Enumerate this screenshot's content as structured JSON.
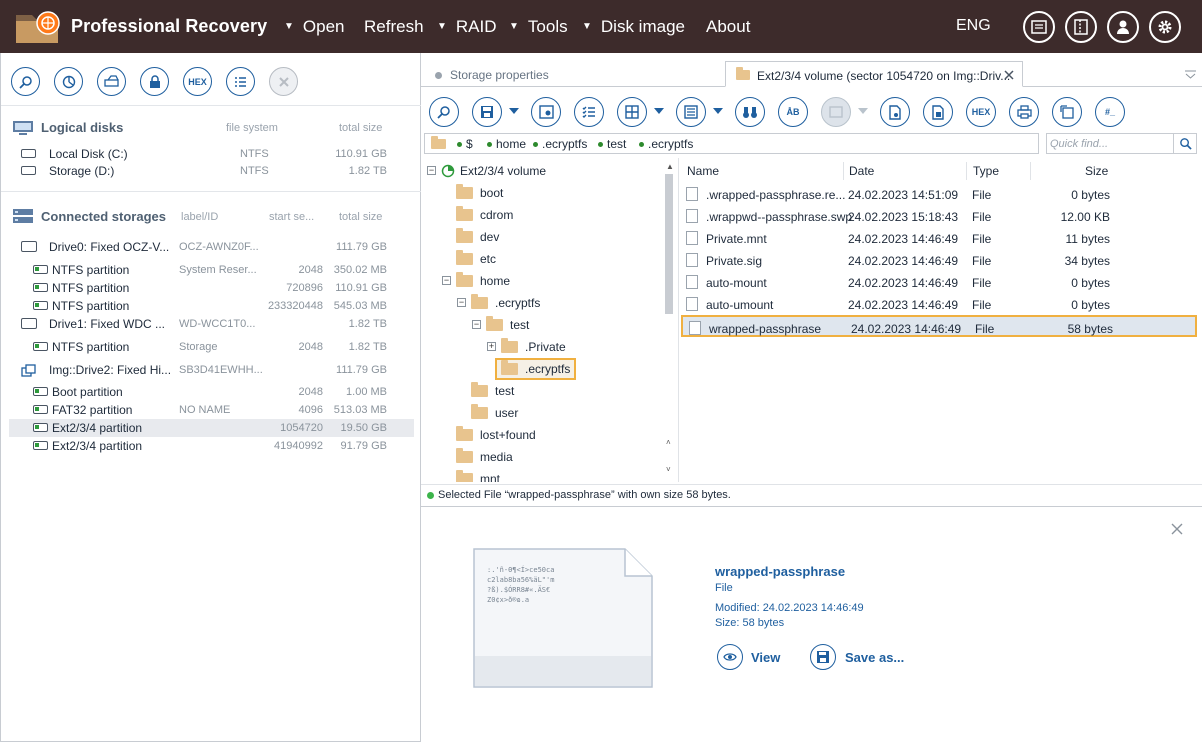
{
  "app": {
    "title": "Professional Recovery",
    "language": "ENG"
  },
  "menu": [
    {
      "label": "Open",
      "arrow": true,
      "x": 0
    },
    {
      "label": "Refresh",
      "arrow": false
    },
    {
      "label": "RAID",
      "arrow": true
    },
    {
      "label": "Tools",
      "arrow": true
    },
    {
      "label": "Disk image",
      "arrow": true
    },
    {
      "label": "About",
      "arrow": false
    }
  ],
  "left_toolbar": {
    "hex_label": "HEX"
  },
  "logical": {
    "title": "Logical disks",
    "col_fs": "file system",
    "col_size": "total size",
    "items": [
      {
        "name": "Local Disk (C:)",
        "fs": "NTFS",
        "size": "110.91 GB"
      },
      {
        "name": "Storage (D:)",
        "fs": "NTFS",
        "size": "1.82 TB"
      }
    ]
  },
  "connected": {
    "title": "Connected storages",
    "col_label": "label/ID",
    "col_start": "start se...",
    "col_size": "total size",
    "items": [
      {
        "name": "Drive0: Fixed OCZ-V...",
        "label": "OCZ-AWNZ0F...",
        "start": "",
        "size": "111.79 GB",
        "kind": "drive"
      },
      {
        "name": "NTFS partition",
        "label": "System Reser...",
        "start": "2048",
        "size": "350.02 MB",
        "kind": "part"
      },
      {
        "name": "NTFS partition",
        "label": "",
        "start": "720896",
        "size": "110.91 GB",
        "kind": "part"
      },
      {
        "name": "NTFS partition",
        "label": "",
        "start": "233320448",
        "size": "545.03 MB",
        "kind": "part"
      },
      {
        "name": "Drive1: Fixed WDC ...",
        "label": "WD-WCC1T0...",
        "start": "",
        "size": "1.82 TB",
        "kind": "drive"
      },
      {
        "name": "NTFS partition",
        "label": "Storage",
        "start": "2048",
        "size": "1.82 TB",
        "kind": "part"
      },
      {
        "name": "Img::Drive2: Fixed Hi...",
        "label": "SB3D41EWHH...",
        "start": "",
        "size": "111.79 GB",
        "kind": "image"
      },
      {
        "name": "Boot partition",
        "label": "",
        "start": "2048",
        "size": "1.00 MB",
        "kind": "part"
      },
      {
        "name": "FAT32 partition",
        "label": "NO NAME",
        "start": "4096",
        "size": "513.03 MB",
        "kind": "part"
      },
      {
        "name": "Ext2/3/4 partition",
        "label": "",
        "start": "1054720",
        "size": "19.50 GB",
        "kind": "part",
        "selected": true
      },
      {
        "name": "Ext2/3/4 partition",
        "label": "",
        "start": "41940992",
        "size": "91.79 GB",
        "kind": "part"
      }
    ]
  },
  "tabs": [
    {
      "label": "Storage properties"
    },
    {
      "label": "Ext2/3/4 volume (sector 1054720 on Img::Driv..."
    }
  ],
  "right_toolbar": {
    "hex_label": "HEX",
    "ab_label": "ÅB",
    "hash_label": "#_"
  },
  "breadcrumb": [
    "$",
    "home",
    ".ecryptfs",
    "test",
    ".ecryptfs"
  ],
  "search": {
    "placeholder": "Quick find..."
  },
  "tree": [
    {
      "label": "Ext2/3/4 volume",
      "level": 0,
      "exp": "minus",
      "root": true
    },
    {
      "label": "boot",
      "level": 1
    },
    {
      "label": "cdrom",
      "level": 1
    },
    {
      "label": "dev",
      "level": 1
    },
    {
      "label": "etc",
      "level": 1
    },
    {
      "label": "home",
      "level": 1,
      "exp": "minus"
    },
    {
      "label": ".ecryptfs",
      "level": 2,
      "exp": "minus"
    },
    {
      "label": "test",
      "level": 3,
      "exp": "minus"
    },
    {
      "label": ".Private",
      "level": 4,
      "exp": "plus"
    },
    {
      "label": ".ecryptfs",
      "level": 4,
      "selected": true
    },
    {
      "label": "test",
      "level": 2
    },
    {
      "label": "user",
      "level": 2
    },
    {
      "label": "lost+found",
      "level": 1
    },
    {
      "label": "media",
      "level": 1
    },
    {
      "label": "mnt",
      "level": 1
    }
  ],
  "files": {
    "headers": {
      "name": "Name",
      "date": "Date",
      "type": "Type",
      "size": "Size"
    },
    "rows": [
      {
        "name": ".wrapped-passphrase.re...",
        "date": "24.02.2023 14:51:09",
        "type": "File",
        "size": "0 bytes"
      },
      {
        "name": ".wrappwd--passphrase.swp",
        "date": "24.02.2023 15:18:43",
        "type": "File",
        "size": "12.00 KB"
      },
      {
        "name": "Private.mnt",
        "date": "24.02.2023 14:46:49",
        "type": "File",
        "size": "11 bytes"
      },
      {
        "name": "Private.sig",
        "date": "24.02.2023 14:46:49",
        "type": "File",
        "size": "34 bytes"
      },
      {
        "name": "auto-mount",
        "date": "24.02.2023 14:46:49",
        "type": "File",
        "size": "0 bytes"
      },
      {
        "name": "auto-umount",
        "date": "24.02.2023 14:46:49",
        "type": "File",
        "size": "0 bytes"
      },
      {
        "name": "wrapped-passphrase",
        "date": "24.02.2023 14:46:49",
        "type": "File",
        "size": "58 bytes",
        "selected": true
      }
    ]
  },
  "status": {
    "text": "Selected File “wrapped-passphrase” with own size 58 bytes."
  },
  "detail": {
    "name": "wrapped-passphrase",
    "type": "File",
    "modified": "Modified: 24.02.2023 14:46:49",
    "size": "Size: 58 bytes",
    "view_label": "View",
    "save_label": "Save as...",
    "preview_lines": [
      ":.'ñ-Θ¶<Í>ce50ca",
      "c2lab8ba56%äL\"'m",
      "?ß).$ÓRR8#«.ÄS€",
      "Z0¢x>ð®ɷ.a"
    ]
  },
  "colors": {
    "accent": "#1f5f9f",
    "topbar": "#3d2b2b",
    "highlight": "#f0b040"
  }
}
